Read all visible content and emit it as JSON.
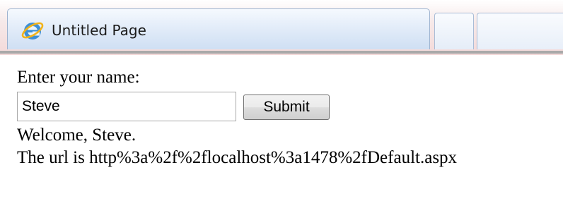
{
  "browser": {
    "tab_title": "Untitled Page",
    "tab_icon": "internet-explorer-icon"
  },
  "form": {
    "prompt_label": "Enter your name:",
    "name_value": "Steve",
    "submit_label": "Submit"
  },
  "output": {
    "welcome_text": "Welcome, Steve.",
    "url_text": "The url is http%3a%2f%2flocalhost%3a1478%2fDefault.aspx"
  }
}
